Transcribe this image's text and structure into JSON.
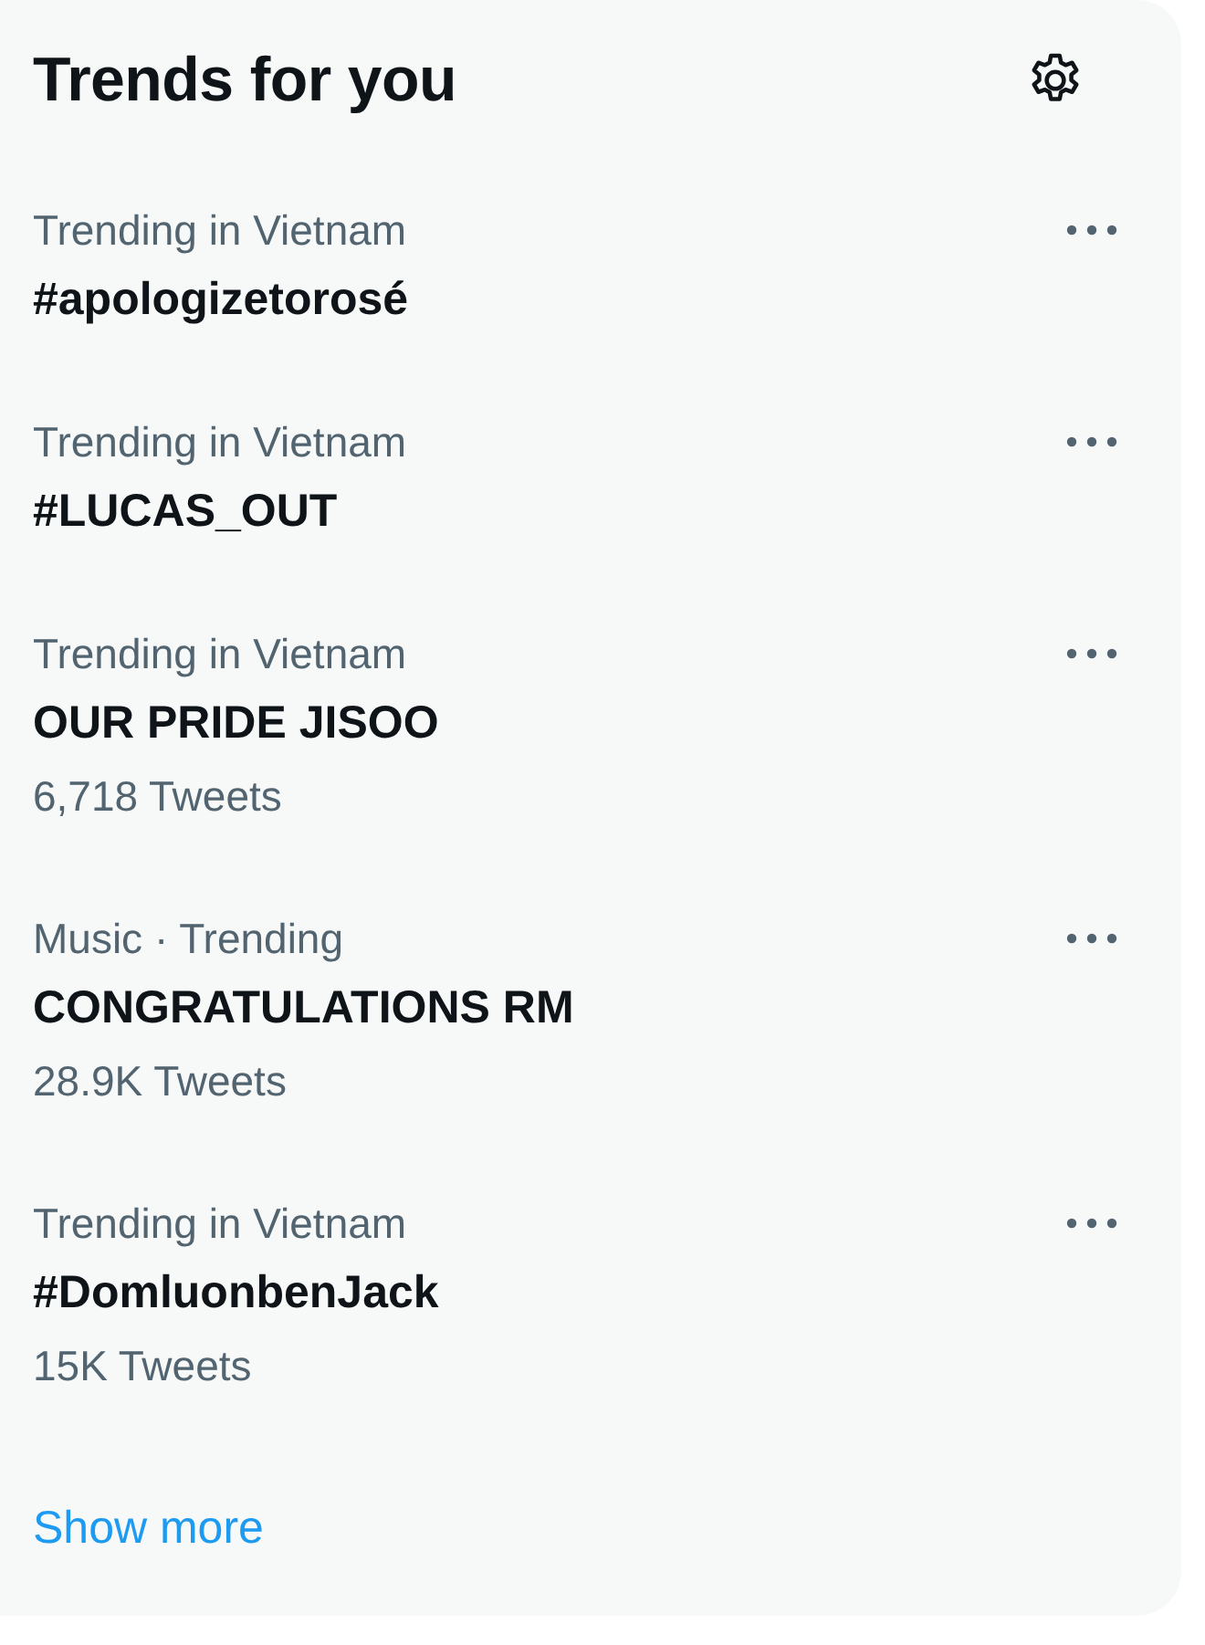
{
  "header": {
    "title": "Trends for you"
  },
  "trends": [
    {
      "context": "Trending in Vietnam",
      "name": "#apologizetorosé"
    },
    {
      "context": "Trending in Vietnam",
      "name": "#LUCAS_OUT"
    },
    {
      "context": "Trending in Vietnam",
      "name": "OUR PRIDE JISOO",
      "count": "6,718 Tweets"
    },
    {
      "context": "Music · Trending",
      "name": "CONGRATULATIONS RM",
      "count": "28.9K Tweets"
    },
    {
      "context": "Trending in Vietnam",
      "name": "#DomluonbenJack",
      "count": "15K Tweets"
    }
  ],
  "show_more": "Show more"
}
